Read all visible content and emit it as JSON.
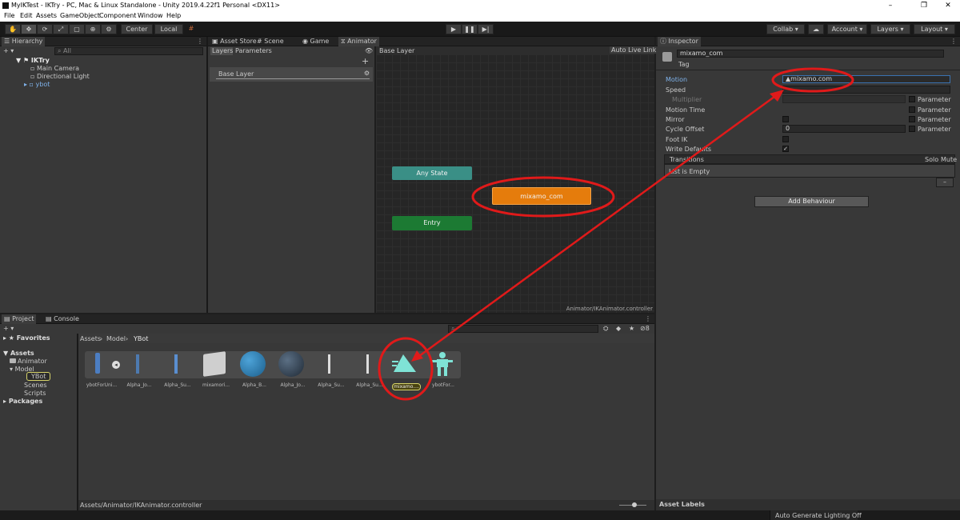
{
  "window": {
    "title": "MyIKTest - IKTry - PC, Mac & Linux Standalone - Unity 2019.4.22f1 Personal <DX11>",
    "minimize": "–",
    "maximize": "❐",
    "close": "✕"
  },
  "menu": [
    "File",
    "Edit",
    "Assets",
    "GameObject",
    "Component",
    "Window",
    "Help"
  ],
  "toolbar": {
    "tools": [
      "hand-tool",
      "move-tool",
      "rotate-tool",
      "scale-tool",
      "rect-tool",
      "transform-tool",
      "custom-tool"
    ],
    "pivot": "Center",
    "space": "Local",
    "collab": "Collab ▾",
    "account": "Account",
    "layers": "Layers",
    "layout": "Layout"
  },
  "hierarchy": {
    "tab": "Hierarchy",
    "search_placeholder": "All",
    "scene": "IKTry",
    "items": [
      "Main Camera",
      "Directional Light",
      "ybot"
    ]
  },
  "center_tabs": [
    "Asset Store",
    "Scene",
    "Game",
    "Animator"
  ],
  "animator": {
    "subtabs": [
      "Layers",
      "Parameters"
    ],
    "breadcrumb": "Base Layer",
    "auto_live_link": "Auto Live Link",
    "layer_name": "Base Layer",
    "nodes": {
      "any_state": "Any State",
      "state": "mixamo_com",
      "entry": "Entry"
    },
    "footer_path": "Animator/IKAnimator.controller"
  },
  "inspector": {
    "tab": "Inspector",
    "name": "mixamo_com",
    "tag_label": "Tag",
    "motion_label": "Motion",
    "motion_value": "mixamo.com",
    "speed_label": "Speed",
    "multiplier_label": "Multiplier",
    "motion_time_label": "Motion Time",
    "mirror_label": "Mirror",
    "cycle_offset_label": "Cycle Offset",
    "cycle_offset_value": "0",
    "foot_ik_label": "Foot IK",
    "write_defaults_label": "Write Defaults",
    "parameter_label": "Parameter",
    "write_defaults_checked": true,
    "transitions_label": "Transitions",
    "solo_label": "Solo",
    "mute_label": "Mute",
    "list_empty": "List is Empty",
    "remove_btn": "–",
    "add_behaviour": "Add Behaviour",
    "asset_labels": "Asset Labels",
    "status": "Auto Generate Lighting Off"
  },
  "project": {
    "tabs": [
      "Project",
      "Console"
    ],
    "breadcrumb": [
      "Assets",
      "Model",
      "YBot"
    ],
    "footer_path": "Assets/Animator/IKAnimator.controller",
    "visible_count": "8",
    "tree": {
      "favorites": "Favorites",
      "assets": "Assets",
      "children": [
        "Animator",
        "Model",
        "YBot",
        "Scenes",
        "Scripts"
      ],
      "packages": "Packages"
    },
    "assets": [
      "ybotForUni...",
      "",
      "Alpha_Jo...",
      "Alpha_Su...",
      "mixamori...",
      "Alpha_B...",
      "Alpha_Jo...",
      "Alpha_Su...",
      "Alpha_Su...",
      "mixamo....",
      "ybotFor..."
    ]
  },
  "colors": {
    "highlight_red": "#e01a1a",
    "state_orange": "#e57c0c",
    "entry_green": "#1c7a33",
    "any_state_teal": "#3a8f86",
    "selection_blue": "#3a72b0"
  }
}
